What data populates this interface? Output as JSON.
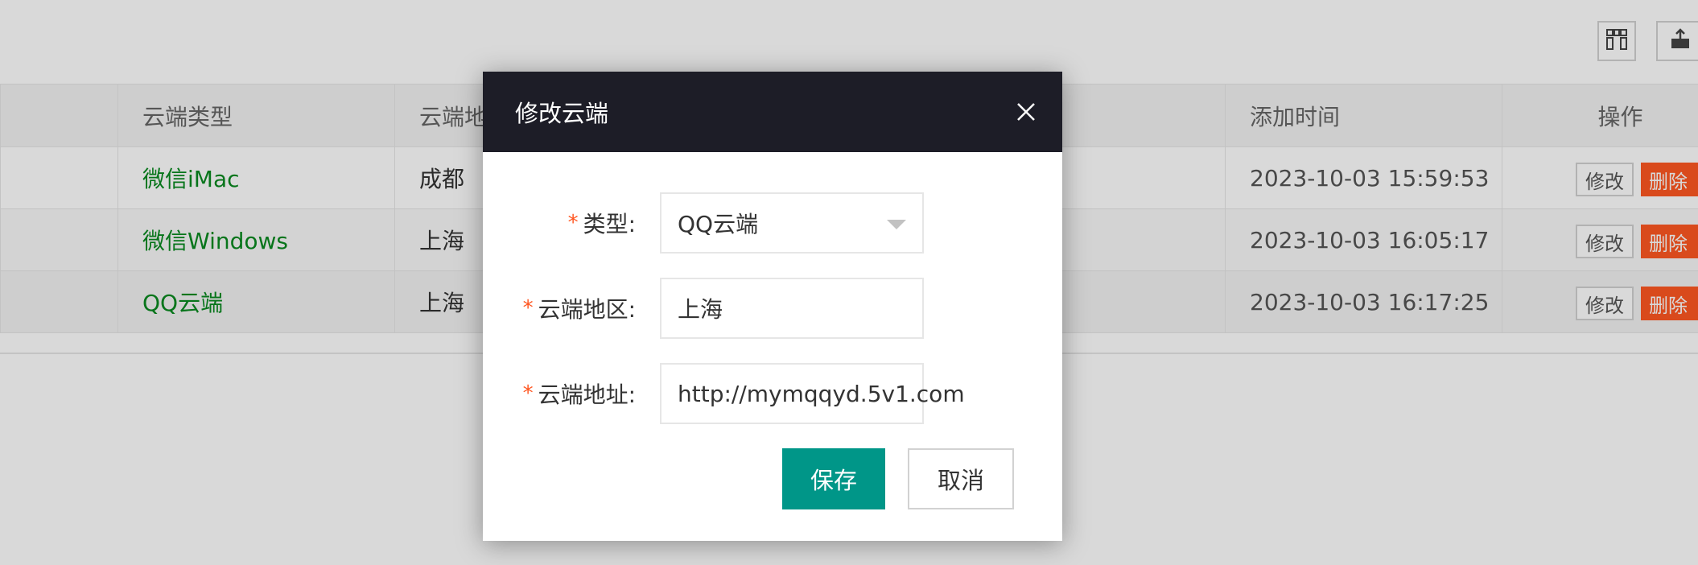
{
  "table": {
    "headers": {
      "type": "云端类型",
      "region": "云端地区",
      "time": "添加时间",
      "ops": "操作"
    },
    "rows": [
      {
        "type": "微信iMac",
        "region": "成都",
        "time": "2023-10-03 15:59:53",
        "edit": "修改",
        "delete": "删除"
      },
      {
        "type": "微信Windows",
        "region": "上海",
        "time": "2023-10-03 16:05:17",
        "edit": "修改",
        "delete": "删除"
      },
      {
        "type": "QQ云端",
        "region": "上海",
        "time": "2023-10-03 16:17:25",
        "edit": "修改",
        "delete": "删除"
      }
    ]
  },
  "toolbar": {
    "columns_icon": "columns-icon",
    "export_icon": "export-icon"
  },
  "dialog": {
    "title": "修改云端",
    "fields": {
      "type": {
        "label": "类型:",
        "value": "QQ云端"
      },
      "region": {
        "label": "云端地区:",
        "value": "上海"
      },
      "address": {
        "label": "云端地址:",
        "value": "http://mymqqyd.5v1.com"
      }
    },
    "required_mark": "*",
    "save_label": "保存",
    "cancel_label": "取消"
  },
  "colors": {
    "header_bg": "#1d1d27",
    "primary": "#009688",
    "danger": "#ff5722",
    "link_green": "#0a8a20"
  }
}
